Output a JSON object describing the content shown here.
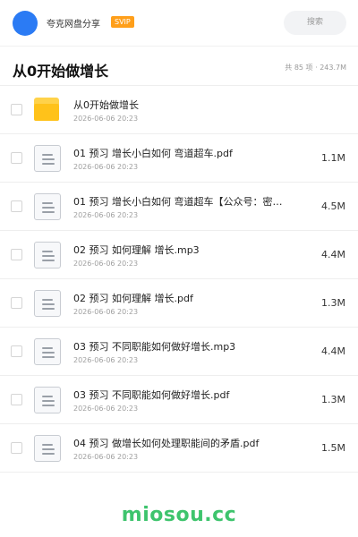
{
  "header": {
    "brand": "夸克网盘分享",
    "badge": "SVIP",
    "search_placeholder": "搜索"
  },
  "page": {
    "title": "从0开始做增长",
    "summary": "共 85 项 · 243.7M"
  },
  "files": [
    {
      "type": "folder",
      "name": "从0开始做增长",
      "date": "2026-06-06 20:23",
      "size": ""
    },
    {
      "type": "file",
      "name": "01 预习   增长小白如何 弯道超车.pdf",
      "date": "2026-06-06 20:23",
      "size": "1.1M"
    },
    {
      "type": "file",
      "name": "01 预习   增长小白如何 弯道超车【公众号：密…",
      "date": "2026-06-06 20:23",
      "size": "4.5M"
    },
    {
      "type": "file",
      "name": "02 预习   如何理解 增长.mp3",
      "date": "2026-06-06 20:23",
      "size": "4.4M"
    },
    {
      "type": "file",
      "name": "02 预习   如何理解 增长.pdf",
      "date": "2026-06-06 20:23",
      "size": "1.3M"
    },
    {
      "type": "file",
      "name": "03 预习   不同职能如何做好增长.mp3",
      "date": "2026-06-06 20:23",
      "size": "4.4M"
    },
    {
      "type": "file",
      "name": "03 预习   不同职能如何做好增长.pdf",
      "date": "2026-06-06 20:23",
      "size": "1.3M"
    },
    {
      "type": "file",
      "name": "04 预习   做增长如何处理职能间的矛盾.pdf",
      "date": "2026-06-06 20:23",
      "size": "1.5M"
    }
  ],
  "watermark": "miosou.cc",
  "colors": {
    "avatar": "#2b7bf4",
    "badge": "#ff9f1a",
    "folder": "#ffc21a",
    "watermark": "#3ec46d"
  }
}
